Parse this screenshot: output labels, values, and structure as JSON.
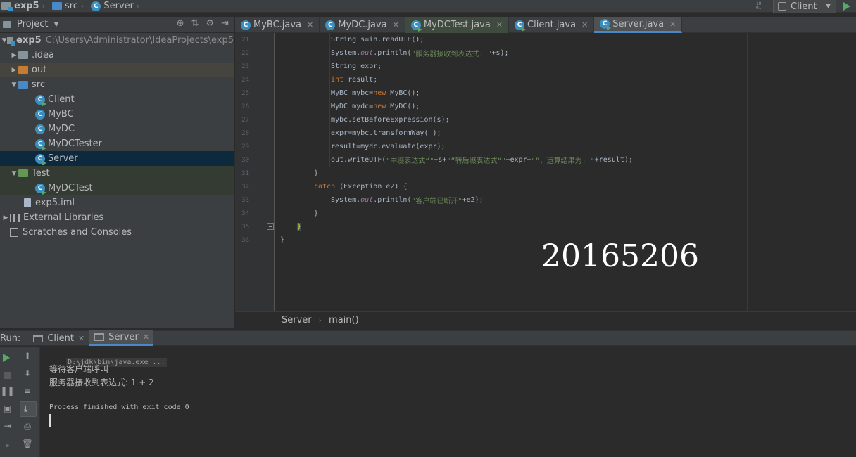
{
  "navbar": {
    "crumbs": [
      "exp5",
      "src",
      "Server"
    ],
    "run_config": "Client"
  },
  "project": {
    "title": "Project",
    "tree": [
      {
        "label": "exp5",
        "hint": "C:\\Users\\Administrator\\IdeaProjects\\exp5"
      },
      {
        "label": ".idea"
      },
      {
        "label": "out"
      },
      {
        "label": "src"
      },
      {
        "label": "Client"
      },
      {
        "label": "MyBC"
      },
      {
        "label": "MyDC"
      },
      {
        "label": "MyDCTester"
      },
      {
        "label": "Server"
      },
      {
        "label": "Test"
      },
      {
        "label": "MyDCTest"
      },
      {
        "label": "exp5.iml"
      },
      {
        "label": "External Libraries"
      },
      {
        "label": "Scratches and Consoles"
      }
    ]
  },
  "tabs": [
    {
      "label": "MyBC.java"
    },
    {
      "label": "MyDC.java"
    },
    {
      "label": "MyDCTest.java"
    },
    {
      "label": "Client.java"
    },
    {
      "label": "Server.java"
    }
  ],
  "editor": {
    "line_numbers": [
      "21",
      "22",
      "23",
      "24",
      "25",
      "26",
      "27",
      "28",
      "29",
      "30",
      "31",
      "32",
      "33",
      "34",
      "35",
      "36"
    ],
    "code": {
      "l21": "String s=in.readUTF();",
      "l22_a": "System.",
      "l22_out": "out",
      "l22_b": ".println(",
      "l22_str": "\"服务器接收到表达式: \"",
      "l22_c": "+s);",
      "l23": "String expr;",
      "l24_kw": "int",
      "l24_b": " result;",
      "l25_a": "MyBC mybc=",
      "l25_kw": "new",
      "l25_b": " MyBC();",
      "l26_a": "MyDC mydc=",
      "l26_kw": "new",
      "l26_b": " MyDC();",
      "l27": "mybc.setBeforeExpression(s);",
      "l28": "expr=mybc.transformWay( );",
      "l29": "result=mydc.evaluate(expr);",
      "l30_a": "out.writeUTF(",
      "l30_s1": "\"中缀表达式“\"",
      "l30_b": "+s+",
      "l30_s2": "\"”转后缀表达式“\"",
      "l30_c": "+expr+",
      "l30_s3": "\"”，运算结果为: \"",
      "l30_d": "+result);",
      "l31": "}",
      "l32_kw": "catch",
      "l32_b": " (Exception e2) {",
      "l33_a": "System.",
      "l33_out": "out",
      "l33_b": ".println(",
      "l33_str": "\"客户端已断开\"",
      "l33_c": "+e2);",
      "l34": "}",
      "l35": "}",
      "l36": "}"
    },
    "watermark": "20165206"
  },
  "editor_crumbs": [
    "Server",
    "main()"
  ],
  "run": {
    "label": "Run:",
    "tabs": [
      {
        "label": "Client"
      },
      {
        "label": "Server"
      }
    ],
    "console": {
      "cmd": "D:\\jdk\\bin\\java.exe ...",
      "line1": "等待客户端呼叫",
      "line2": "服务器接收到表达式: 1 + 2",
      "line3": "Process finished with exit code 0"
    }
  },
  "colors": {
    "accent": "#4a88c7",
    "run_green": "#59a869",
    "keyword": "#cc7832",
    "string": "#6a8759"
  }
}
